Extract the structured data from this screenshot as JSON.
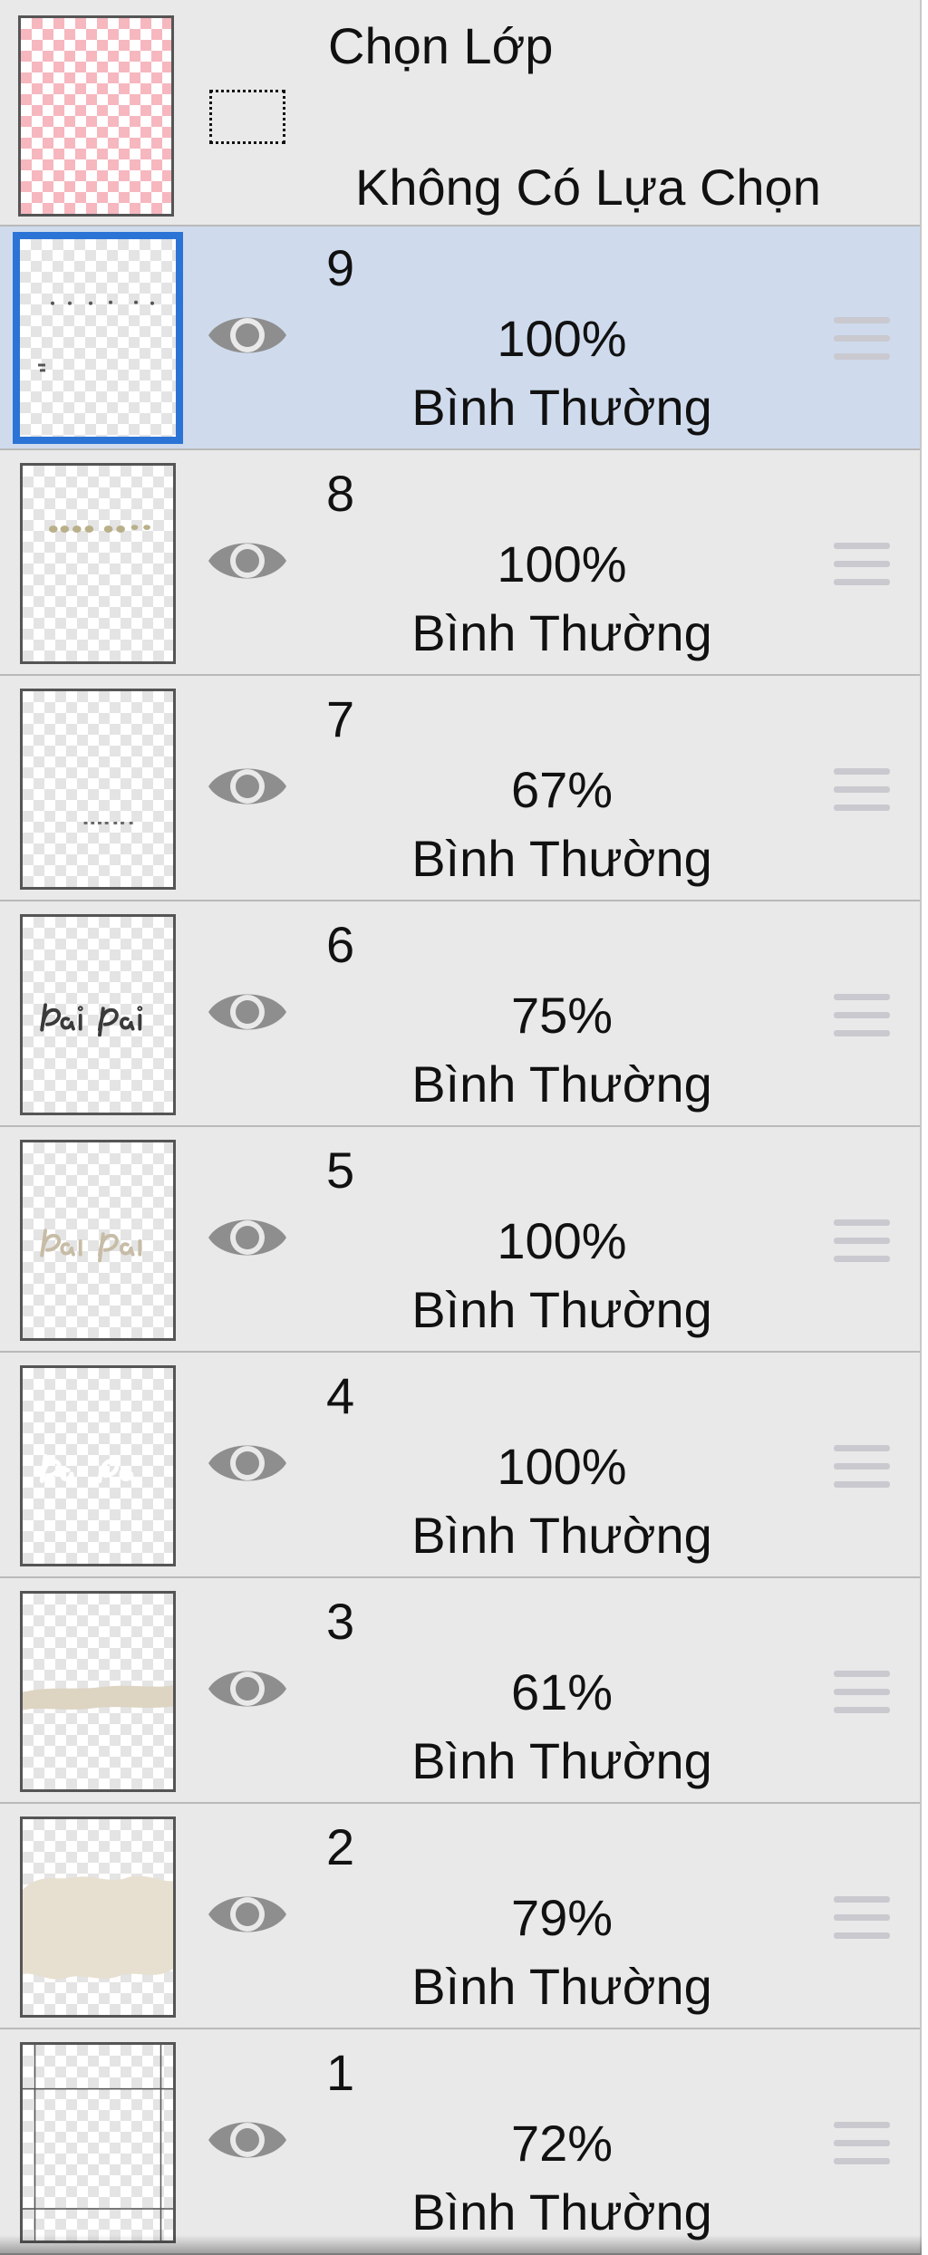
{
  "selection": {
    "title": "Chọn Lớp",
    "status": "Không Có Lựa Chọn"
  },
  "layers": [
    {
      "name": "9",
      "opacity": "100%",
      "blend": "Bình Thường",
      "selected": true,
      "thumb": "tiny-marks"
    },
    {
      "name": "8",
      "opacity": "100%",
      "blend": "Bình Thường",
      "selected": false,
      "thumb": "small-text-beige"
    },
    {
      "name": "7",
      "opacity": "67%",
      "blend": "Bình Thường",
      "selected": false,
      "thumb": "tiny-text-low"
    },
    {
      "name": "6",
      "opacity": "75%",
      "blend": "Bình Thường",
      "selected": false,
      "thumb": "script-dark"
    },
    {
      "name": "5",
      "opacity": "100%",
      "blend": "Bình Thường",
      "selected": false,
      "thumb": "script-beige"
    },
    {
      "name": "4",
      "opacity": "100%",
      "blend": "Bình Thường",
      "selected": false,
      "thumb": "script-white"
    },
    {
      "name": "3",
      "opacity": "61%",
      "blend": "Bình Thường",
      "selected": false,
      "thumb": "beige-stroke"
    },
    {
      "name": "2",
      "opacity": "79%",
      "blend": "Bình Thường",
      "selected": false,
      "thumb": "beige-blob"
    },
    {
      "name": "1",
      "opacity": "72%",
      "blend": "Bình Thường",
      "selected": false,
      "thumb": "guide-lines"
    }
  ],
  "icons": {
    "visibility": "eye-icon",
    "reorder": "drag-handle-icon",
    "selection": "selection-marquee-icon"
  },
  "colors": {
    "panel_bg": "#e9e9e9",
    "selected_row": "#cfdbed",
    "selected_border": "#2b74d6",
    "eye": "#8e8e8e",
    "handle": "#c9c9cf"
  }
}
